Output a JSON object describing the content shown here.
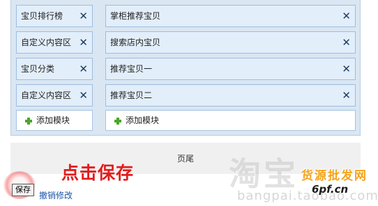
{
  "left_column": {
    "modules": [
      {
        "label": "宝贝排行榜"
      },
      {
        "label": "自定义内容区"
      },
      {
        "label": "宝贝分类"
      },
      {
        "label": "自定义内容区"
      }
    ],
    "add_label": "添加模块"
  },
  "right_column": {
    "modules": [
      {
        "label": "掌柜推荐宝贝"
      },
      {
        "label": "搜索店内宝贝"
      },
      {
        "label": "推荐宝贝一"
      },
      {
        "label": "推荐宝贝二"
      }
    ],
    "add_label": "添加模块"
  },
  "icons": {
    "remove": "close-icon",
    "add": "plus-icon"
  },
  "close_glyph": "✕",
  "footer": {
    "label": "页尾"
  },
  "annotation": {
    "text": "点击保存",
    "color": "#e31c1c"
  },
  "actions": {
    "save_label": "保存",
    "undo_label": "撤销修改"
  },
  "watermark": {
    "big_text": "淘宝",
    "url_text": "bangpai.taobao.com",
    "logo_text": "货源批发网",
    "logo_sub": "6pf.cn"
  }
}
